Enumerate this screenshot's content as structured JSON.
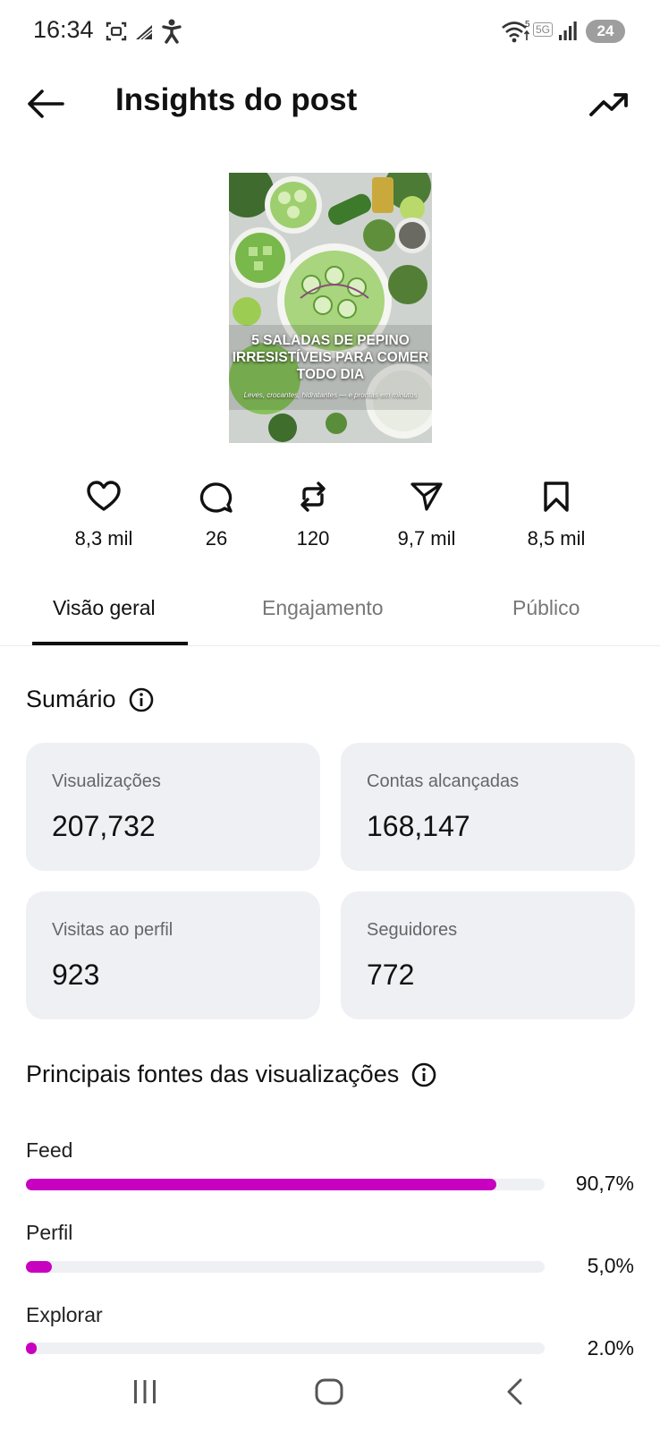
{
  "status_bar": {
    "time": "16:34",
    "network": "5G",
    "battery": "24",
    "icons": [
      "screenshot-icon",
      "signal-wave-icon",
      "accessibility-icon",
      "wifi-icon",
      "cell-signal-icon",
      "battery-icon"
    ]
  },
  "header": {
    "title": "Insights do post",
    "back_icon": "arrow-left-icon",
    "trend_icon": "trending-up-icon"
  },
  "post": {
    "thumbnail_title": "5 SALADAS DE PEPINO IRRESISTÍVEIS PARA COMER TODO DIA",
    "thumbnail_subtitle": "Leves, crocantes, hidratantes — e prontas em minutos"
  },
  "metrics": [
    {
      "icon": "heart-icon",
      "value": "8,3 mil"
    },
    {
      "icon": "comment-icon",
      "value": "26"
    },
    {
      "icon": "repost-icon",
      "value": "120"
    },
    {
      "icon": "send-icon",
      "value": "9,7 mil"
    },
    {
      "icon": "bookmark-icon",
      "value": "8,5 mil"
    }
  ],
  "tabs": [
    {
      "label": "Visão geral",
      "active": true
    },
    {
      "label": "Engajamento",
      "active": false
    },
    {
      "label": "Público",
      "active": false
    }
  ],
  "summary": {
    "title": "Sumário",
    "cards": [
      {
        "label": "Visualizações",
        "value": "207,732"
      },
      {
        "label": "Contas alcançadas",
        "value": "168,147"
      },
      {
        "label": "Visitas ao perfil",
        "value": "923"
      },
      {
        "label": "Seguidores",
        "value": "772"
      }
    ]
  },
  "sources": {
    "title": "Principais fontes das visualizações",
    "accent_color": "#c800c0",
    "items": [
      {
        "label": "Feed",
        "percent_text": "90,7%",
        "fraction": 0.907
      },
      {
        "label": "Perfil",
        "percent_text": "5,0%",
        "fraction": 0.05
      },
      {
        "label": "Explorar",
        "percent_text": "2.0%",
        "fraction": 0.02
      }
    ]
  },
  "nav": {
    "icons": [
      "recents-icon",
      "home-icon",
      "back-icon"
    ]
  }
}
